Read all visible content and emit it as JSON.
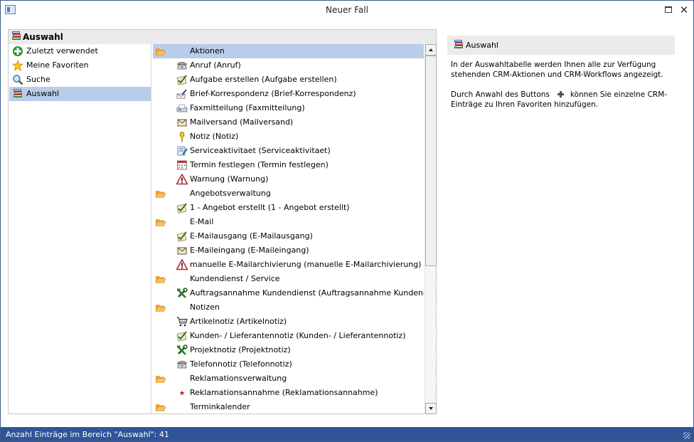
{
  "window": {
    "title": "Neuer Fall"
  },
  "left_panel": {
    "header": "Auswahl",
    "nav": [
      {
        "label": "Zuletzt verwendet",
        "icon": "plus-green-icon"
      },
      {
        "label": "Meine Favoriten",
        "icon": "star-icon"
      },
      {
        "label": "Suche",
        "icon": "magnifier-icon"
      },
      {
        "label": "Auswahl",
        "icon": "books-icon",
        "selected": true
      }
    ]
  },
  "tree": [
    {
      "type": "group",
      "label": "Aktionen",
      "icon": "folder-open-icon",
      "selected": true
    },
    {
      "type": "item",
      "label": "Anruf (Anruf)",
      "icon": "telephone-icon"
    },
    {
      "type": "item",
      "label": "Aufgabe erstellen (Aufgabe erstellen)",
      "icon": "checklist-icon"
    },
    {
      "type": "item",
      "label": "Brief-Korrespondenz (Brief-Korrespondenz)",
      "icon": "letter-pen-icon"
    },
    {
      "type": "item",
      "label": "Faxmitteilung (Faxmitteilung)",
      "icon": "fax-icon"
    },
    {
      "type": "item",
      "label": "Mailversand (Mailversand)",
      "icon": "envelope-icon"
    },
    {
      "type": "item",
      "label": "Notiz (Notiz)",
      "icon": "pin-icon"
    },
    {
      "type": "item",
      "label": "Serviceaktivitaet (Serviceaktivitaet)",
      "icon": "service-icon"
    },
    {
      "type": "item",
      "label": "Termin festlegen (Termin festlegen)",
      "icon": "calendar-icon"
    },
    {
      "type": "item",
      "label": "Warnung (Warnung)",
      "icon": "warning-icon"
    },
    {
      "type": "group",
      "label": "Angebotsverwaltung",
      "icon": "folder-open-icon"
    },
    {
      "type": "item",
      "label": "1 - Angebot erstellt (1 - Angebot erstellt)",
      "icon": "checklist-icon"
    },
    {
      "type": "group",
      "label": "E-Mail",
      "icon": "folder-open-icon"
    },
    {
      "type": "item",
      "label": "E-Mailausgang (E-Mailausgang)",
      "icon": "checklist-icon"
    },
    {
      "type": "item",
      "label": "E-Maileingang (E-Maileingang)",
      "icon": "envelope-icon"
    },
    {
      "type": "item",
      "label": "manuelle E-Mailarchivierung (manuelle E-Mailarchivierung)",
      "icon": "warning-icon"
    },
    {
      "type": "group",
      "label": "Kundendienst / Service",
      "icon": "folder-open-icon"
    },
    {
      "type": "item",
      "label": "Auftragsannahme Kundendienst (Auftragsannahme Kundendienst)",
      "icon": "tools-icon"
    },
    {
      "type": "group",
      "label": "Notizen",
      "icon": "folder-open-icon"
    },
    {
      "type": "item",
      "label": "Artikelnotiz (Artikelnotiz)",
      "icon": "cart-icon"
    },
    {
      "type": "item",
      "label": "Kunden- / Lieferantennotiz (Kunden- / Lieferantennotiz)",
      "icon": "checklist-icon"
    },
    {
      "type": "item",
      "label": "Projektnotiz (Projektnotiz)",
      "icon": "tools-icon"
    },
    {
      "type": "item",
      "label": "Telefonnotiz (Telefonnotiz)",
      "icon": "telephone-icon"
    },
    {
      "type": "group",
      "label": "Reklamationsverwaltung",
      "icon": "folder-open-icon"
    },
    {
      "type": "item",
      "label": "Reklamationsannahme (Reklamationsannahme)",
      "icon": "red-star-icon"
    },
    {
      "type": "group",
      "label": "Terminkalender",
      "icon": "folder-open-icon"
    }
  ],
  "right_panel": {
    "header": "Auswahl",
    "text1": "In der Auswahltabelle werden Ihnen alle zur Verfügung stehenden CRM-Aktionen und CRM-Workflows angezeigt.",
    "text2_before": "Durch Anwahl des Buttons",
    "text2_after": "können Sie einzelne CRM-Einträge zu Ihren Favoriten hinzufügen."
  },
  "statusbar": {
    "text": "Anzahl Einträge im Bereich \"Auswahl\": 41"
  }
}
